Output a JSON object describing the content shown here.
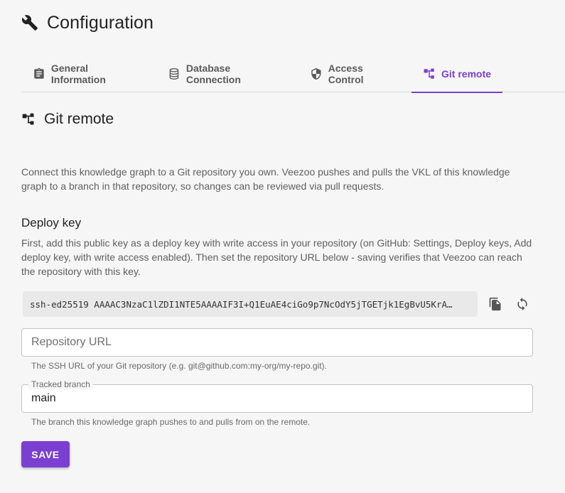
{
  "header": {
    "title": "Configuration",
    "icon": "wrench-icon"
  },
  "tabs": [
    {
      "label": "General Information",
      "icon": "clipboard-icon",
      "active": false
    },
    {
      "label": "Database Connection",
      "icon": "database-icon",
      "active": false
    },
    {
      "label": "Access Control",
      "icon": "shield-icon",
      "active": false
    },
    {
      "label": "Git remote",
      "icon": "git-branch-icon",
      "active": true
    }
  ],
  "section": {
    "title": "Git remote",
    "icon": "git-branch-icon",
    "description": "Connect this knowledge graph to a Git repository you own. Veezoo pushes and pulls the VKL of this knowledge graph to a branch in that repository, so changes can be reviewed via pull requests."
  },
  "deploy": {
    "title": "Deploy key",
    "description": "First, add this public key as a deploy key with write access in your repository (on GitHub: Settings, Deploy keys, Add deploy key, with write access enabled). Then set the repository URL below - saving verifies that Veezoo can reach the repository with this key.",
    "key": "ssh-ed25519 AAAAC3NzaC1lZDI1NTE5AAAAIF3I+Q1EuAE4ciGo9p7NcOdY5jTGETjk1EgBvU5KrA…",
    "copy_icon": "copy-icon",
    "regenerate_icon": "refresh-icon"
  },
  "repo": {
    "value": "",
    "placeholder": "Repository URL",
    "helper": "The SSH URL of your Git repository (e.g. git@github.com:my-org/my-repo.git)."
  },
  "branch": {
    "label": "Tracked branch",
    "value": "main",
    "helper": "The branch this knowledge graph pushes to and pulls from on the remote."
  },
  "actions": {
    "save_label": "SAVE"
  },
  "colors": {
    "accent": "#7b3fd2",
    "background": "#f6f6f6"
  }
}
